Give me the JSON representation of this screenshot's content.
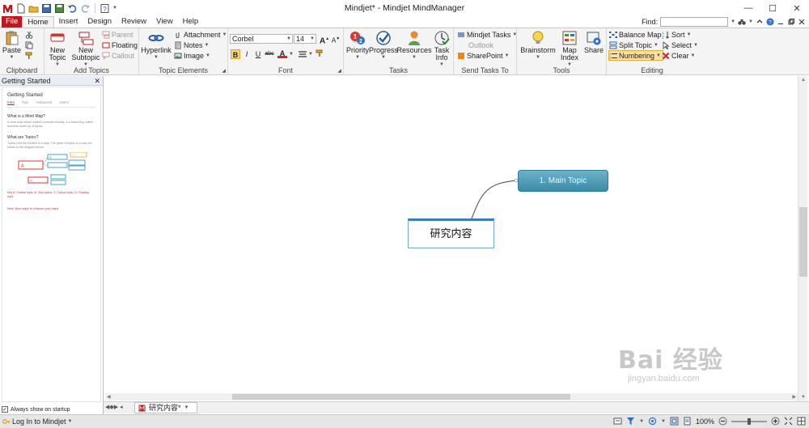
{
  "window": {
    "title": "Mindjet* - Mindjet MindManager",
    "minimize": "—",
    "maximize": "☐",
    "close": "✕"
  },
  "ribbon_tabs": [
    "File",
    "Home",
    "Insert",
    "Design",
    "Review",
    "View",
    "Help"
  ],
  "find": {
    "label": "Find:",
    "value": ""
  },
  "clipboard": {
    "paste": "Paste",
    "label": "Clipboard"
  },
  "add_topics": {
    "new_topic": "New Topic",
    "new_subtopic": "New Subtopic",
    "parent": "Parent",
    "floating": "Floating",
    "callout": "Callout",
    "label": "Add Topics"
  },
  "topic_elements": {
    "hyperlink": "Hyperlink",
    "attachment": "Attachment",
    "notes": "Notes",
    "image": "Image",
    "label": "Topic Elements"
  },
  "font": {
    "family": "Corbel",
    "size": "14",
    "bold": "B",
    "italic": "I",
    "underline": "U",
    "strike": "abc",
    "color_glyph": "A",
    "label": "Font"
  },
  "tasks": {
    "priority": "Priority",
    "progress": "Progress",
    "resources": "Resources",
    "task_info": "Task Info",
    "label": "Tasks"
  },
  "send_tasks": {
    "mindjet_tasks": "Mindjet Tasks",
    "outlook": "Outlook",
    "sharepoint": "SharePoint",
    "label": "Send Tasks To"
  },
  "tools": {
    "brainstorm": "Brainstorm",
    "map_index": "Map Index",
    "share": "Share",
    "label": "Tools"
  },
  "editing": {
    "balance_map": "Balance Map",
    "split_topic": "Split Topic",
    "numbering": "Numbering",
    "sort": "Sort",
    "select": "Select",
    "clear": "Clear",
    "label": "Editing"
  },
  "left_panel": {
    "header": "Getting Started",
    "title": "Getting Started",
    "tabs": [
      "Intro",
      "Tips",
      "Advanced",
      "Users"
    ],
    "q1": "What is a Mind Map?",
    "p1": "A mind map shows related concepts visually, in a branching outline structure made up of topics.",
    "q2": "What are Topics?",
    "p2": "Topics hold the content of a map. The types of topics in a map are shown in the diagram below.",
    "key": "Key A: Central topic, B: Sub-topics, C: Callout topic, D: Floating topic",
    "next": "Next: More ways to enhance your maps",
    "diagram_a": "A",
    "diagram_b": "B",
    "diagram_c": "C",
    "diagram_d": "D",
    "always_show": "Always show on startup"
  },
  "map": {
    "central_topic": "研究内容",
    "main_topic": "1. Main Topic"
  },
  "doc_tab": {
    "name": "研究内容*"
  },
  "status": {
    "login": "Log In to Mindjet",
    "zoom": "100%"
  },
  "watermark": {
    "main": "Bai 经验",
    "sub": "jingyan.baidu.com"
  },
  "colors": {
    "file_tab": "#c5161d",
    "main_topic_fill": "#4a9ab6",
    "central_border": "#3a7bc8",
    "ribbon_bg": "#f4f4f4"
  }
}
